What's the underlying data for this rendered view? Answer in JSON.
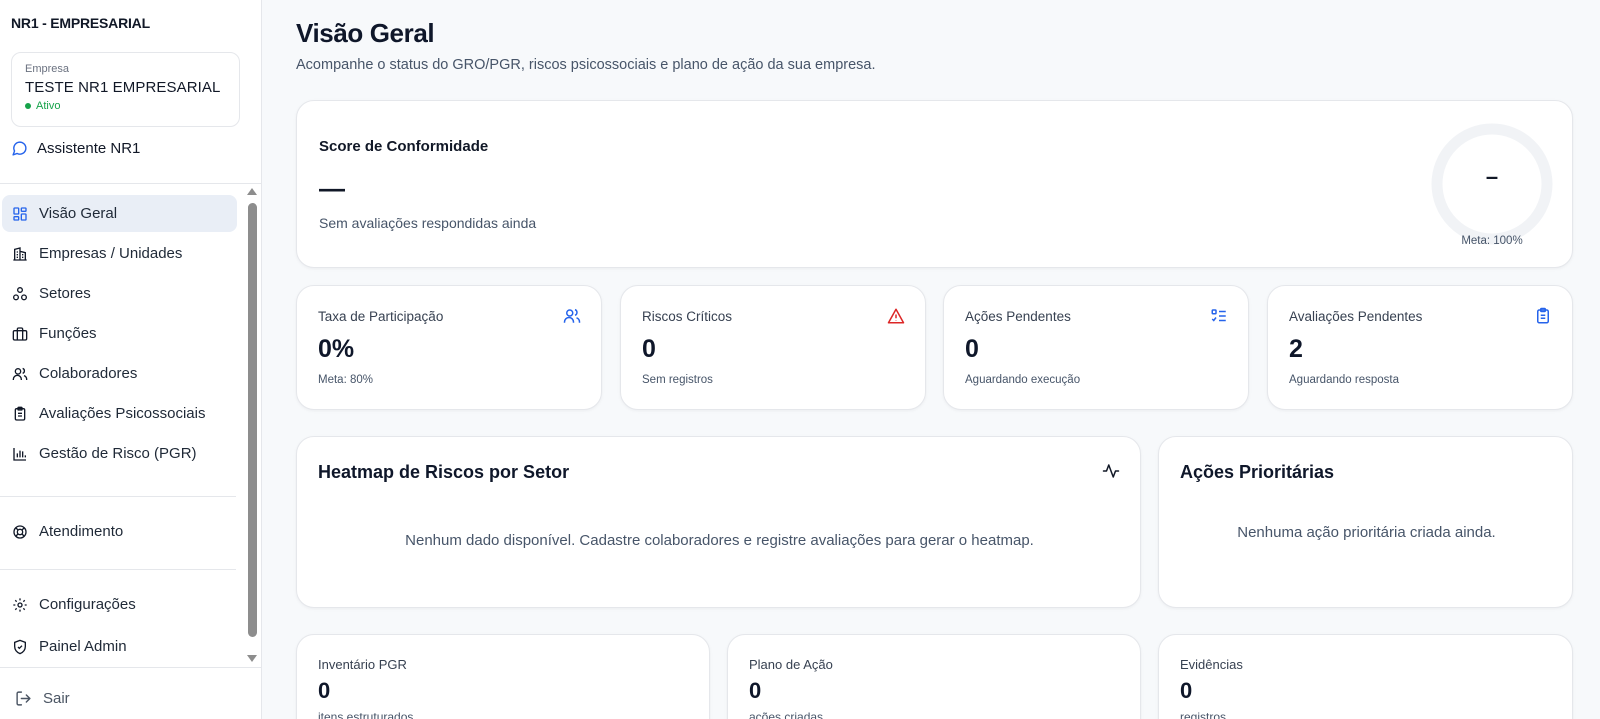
{
  "sidebar": {
    "brand": "NR1 - EMPRESARIAL",
    "company": {
      "label": "Empresa",
      "name": "TESTE NR1 EMPRESARIAL",
      "status": "Ativo"
    },
    "assistant": "Assistente NR1",
    "nav": [
      {
        "label": "Visão Geral",
        "icon": "dashboard-icon",
        "active": true
      },
      {
        "label": "Empresas / Unidades",
        "icon": "building-icon"
      },
      {
        "label": "Setores",
        "icon": "network-icon"
      },
      {
        "label": "Funções",
        "icon": "briefcase-icon"
      },
      {
        "label": "Colaboradores",
        "icon": "users-icon"
      },
      {
        "label": "Avaliações Psicossociais",
        "icon": "clipboard-icon"
      },
      {
        "label": "Gestão de Risco (PGR)",
        "icon": "bar-chart-icon"
      }
    ],
    "support": "Atendimento",
    "settings": "Configurações",
    "admin": "Painel Admin",
    "logout": "Sair"
  },
  "main": {
    "title": "Visão Geral",
    "subtitle": "Acompanhe o status do GRO/PGR, riscos psicossociais e plano de ação da sua empresa.",
    "score": {
      "title": "Score de Conformidade",
      "value": "—",
      "description": "Sem avaliações respondidas ainda",
      "gauge_value": "–",
      "gauge_meta": "Meta: 100%"
    },
    "stats": [
      {
        "label": "Taxa de Participação",
        "value": "0%",
        "sub": "Meta: 80%",
        "icon": "users-icon",
        "color": "#2563eb"
      },
      {
        "label": "Riscos Críticos",
        "value": "0",
        "sub": "Sem registros",
        "icon": "alert-triangle-icon",
        "color": "#dc2626"
      },
      {
        "label": "Ações Pendentes",
        "value": "0",
        "sub": "Aguardando execução",
        "icon": "checklist-icon",
        "color": "#2563eb"
      },
      {
        "label": "Avaliações Pendentes",
        "value": "2",
        "sub": "Aguardando resposta",
        "icon": "clipboard-icon",
        "color": "#2563eb"
      }
    ],
    "heatmap": {
      "title": "Heatmap de Riscos por Setor",
      "empty": "Nenhum dado disponível. Cadastre colaboradores e registre avaliações para gerar o heatmap."
    },
    "priority": {
      "title": "Ações Prioritárias",
      "empty": "Nenhuma ação prioritária criada ainda."
    },
    "bottom_cards": [
      {
        "label": "Inventário PGR",
        "value": "0",
        "sub": "itens estruturados"
      },
      {
        "label": "Plano de Ação",
        "value": "0",
        "sub": "ações criadas"
      },
      {
        "label": "Evidências",
        "value": "0",
        "sub": "registros"
      }
    ]
  }
}
